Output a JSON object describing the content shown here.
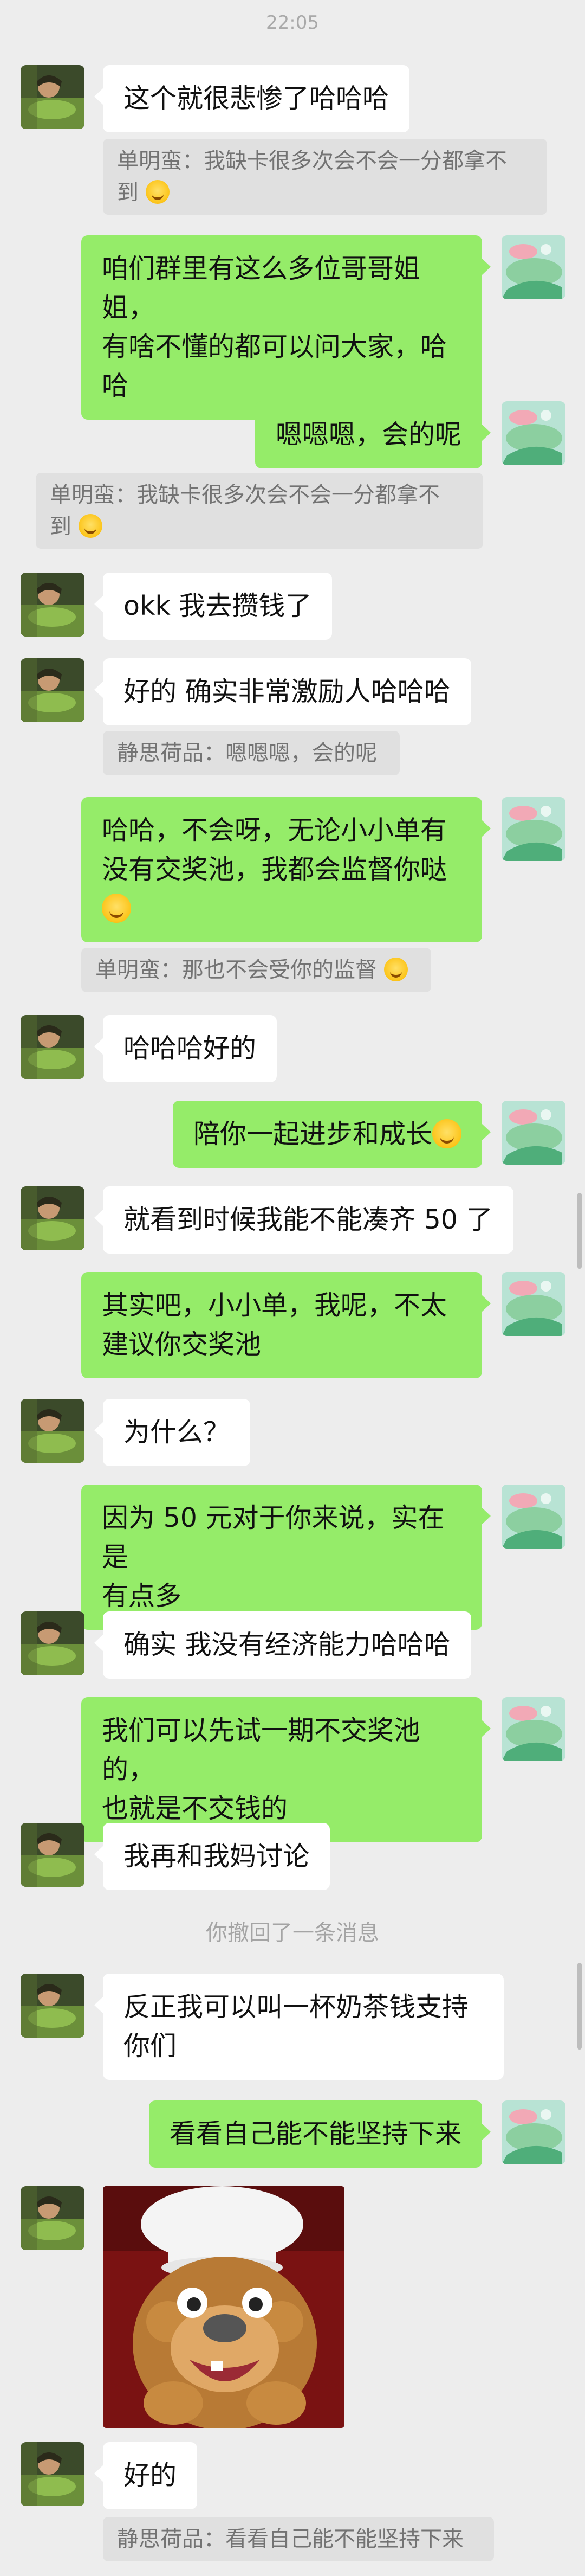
{
  "time": "22:05",
  "messages": {
    "m1": "这个就很悲惨了哈哈哈",
    "q1_name": "单明蛮：",
    "q1_text_a": "我缺卡很多次会不会一分都拿不",
    "q1_text_b": "到",
    "m2_a": "咱们群里有这么多位哥哥姐姐，",
    "m2_b": "有啥不懂的都可以问大家，",
    "m2_b2": "哈",
    "m2_c": "哈",
    "m3": "嗯嗯嗯，会的呢",
    "q2_name": "单明蛮：",
    "q2_text_a": "我缺卡很多次会不会一分都拿不",
    "q2_text_b": "到",
    "m4": "okk 我去攒钱了",
    "m5": "好的 确实非常激励人哈哈哈",
    "q3": "静思荷品：嗯嗯嗯，会的呢",
    "m6_a": "哈哈，不会呀，无论小小单有",
    "m6_b": "没有交奖池，我都会监督你哒",
    "q4": "单明蛮：那也不会受你的监督",
    "m7": "哈哈哈好的",
    "m8": "陪你一起进步和成长",
    "m9": "就看到时候我能不能凑齐 50 了",
    "m10_a": "其实吧，小小单，我呢，不太",
    "m10_b": "建议你交奖池",
    "m11": "为什么？",
    "m12_a": "因为 50 元对于你来说，实在是",
    "m12_b": "有点多",
    "m13": "确实 我没有经济能力哈哈哈",
    "m14_a": "我们可以先试一期不交奖池的，",
    "m14_b": "也就是不交钱的",
    "m15": "我再和我妈讨论",
    "sys1": "你撤回了一条消息",
    "m16_a": "反正我可以叫一杯奶茶钱支持",
    "m16_b": "你们",
    "m17": "看看自己能不能坚持下来",
    "m18": "好的",
    "q5": "静思荷品：看看自己能不能坚持下来"
  },
  "colors": {
    "background": "#ededed",
    "incoming_bubble": "#ffffff",
    "outgoing_bubble": "#95ec69",
    "quote_bg": "#e0e0e0"
  }
}
